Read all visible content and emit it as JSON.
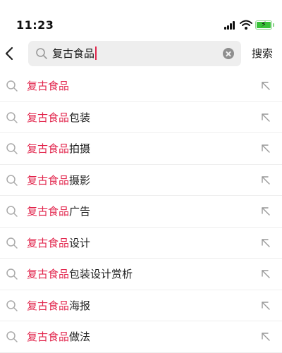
{
  "status_bar": {
    "time": "11:23"
  },
  "search": {
    "value": "复古食品",
    "submit_label": "搜索"
  },
  "colors": {
    "highlight": "#e2264d",
    "search_box_bg": "#eeeeee",
    "battery": "#38c238"
  },
  "suggestions": [
    {
      "highlight": "复古食品",
      "rest": ""
    },
    {
      "highlight": "复古食品",
      "rest": "包装"
    },
    {
      "highlight": "复古食品",
      "rest": "拍摄"
    },
    {
      "highlight": "复古食品",
      "rest": "摄影"
    },
    {
      "highlight": "复古食品",
      "rest": "广告"
    },
    {
      "highlight": "复古食品",
      "rest": "设计"
    },
    {
      "highlight": "复古食品",
      "rest": "包装设计赏析"
    },
    {
      "highlight": "复古食品",
      "rest": "海报"
    },
    {
      "highlight": "复古食品",
      "rest": "做法"
    }
  ],
  "icons": {
    "back": "chevron-left-icon",
    "search": "search-icon",
    "clear": "clear-icon",
    "fill": "arrow-up-left-icon",
    "signal": "cellular-signal-icon",
    "wifi": "wifi-icon",
    "battery": "battery-charging-icon"
  }
}
